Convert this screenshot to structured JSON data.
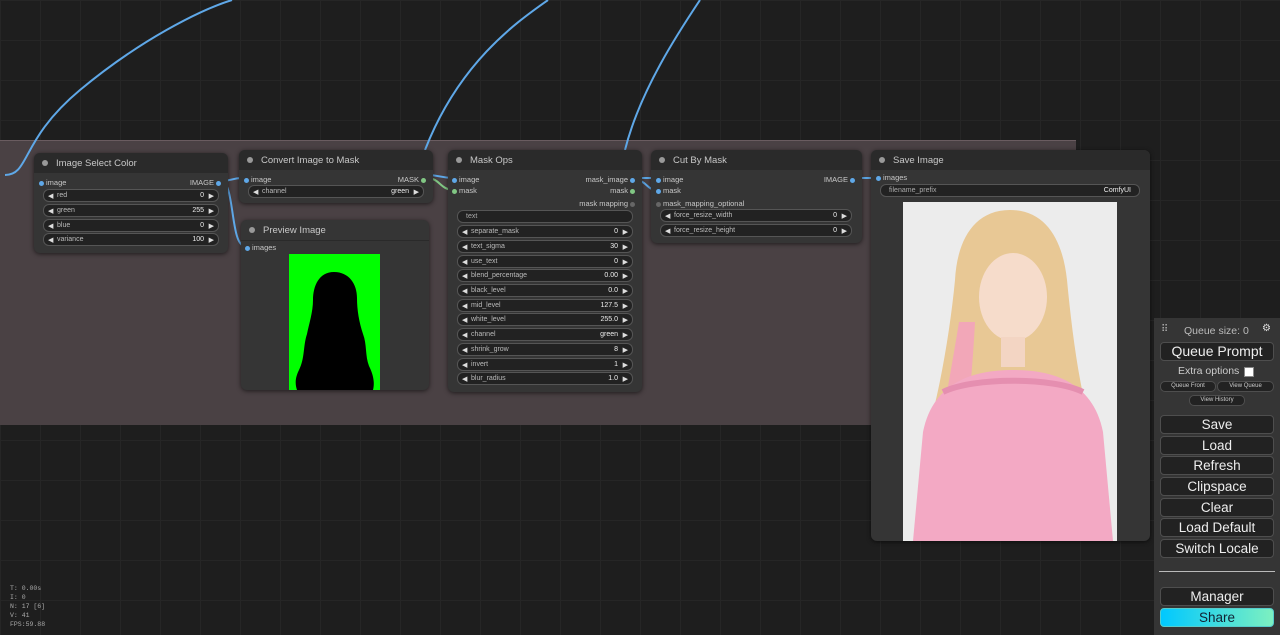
{
  "nodes": {
    "image_select_color": {
      "title": "Image Select Color",
      "input": "image",
      "output": "IMAGE",
      "widgets": [
        {
          "label": "red",
          "value": "0"
        },
        {
          "label": "green",
          "value": "255"
        },
        {
          "label": "blue",
          "value": "0"
        },
        {
          "label": "variance",
          "value": "100"
        }
      ]
    },
    "convert_image_to_mask": {
      "title": "Convert Image to Mask",
      "input": "image",
      "output": "MASK",
      "widgets": [
        {
          "label": "channel",
          "value": "green"
        }
      ]
    },
    "preview_image": {
      "title": "Preview Image",
      "input": "images"
    },
    "mask_ops": {
      "title": "Mask Ops",
      "inputs": [
        "image",
        "mask",
        "mask mapping"
      ],
      "outputs": [
        "mask_image",
        "mask"
      ],
      "text_placeholder": "text",
      "widgets": [
        {
          "label": "separate_mask",
          "value": "0"
        },
        {
          "label": "text_sigma",
          "value": "30"
        },
        {
          "label": "use_text",
          "value": "0"
        },
        {
          "label": "blend_percentage",
          "value": "0.00"
        },
        {
          "label": "black_level",
          "value": "0.0"
        },
        {
          "label": "mid_level",
          "value": "127.5"
        },
        {
          "label": "white_level",
          "value": "255.0"
        },
        {
          "label": "channel",
          "value": "green"
        },
        {
          "label": "shrink_grow",
          "value": "8"
        },
        {
          "label": "invert",
          "value": "1"
        },
        {
          "label": "blur_radius",
          "value": "1.0"
        }
      ]
    },
    "cut_by_mask": {
      "title": "Cut By Mask",
      "inputs": [
        "image",
        "mask",
        "mask_mapping_optional"
      ],
      "output": "IMAGE",
      "widgets": [
        {
          "label": "force_resize_width",
          "value": "0"
        },
        {
          "label": "force_resize_height",
          "value": "0"
        }
      ]
    },
    "save_image": {
      "title": "Save Image",
      "input": "images",
      "widgets": [
        {
          "label": "filename_prefix",
          "value": "ComfyUI"
        }
      ]
    }
  },
  "menu": {
    "queue_size": "Queue size: 0",
    "queue_prompt": "Queue Prompt",
    "extra_options": "Extra options",
    "queue_front": "Queue Front",
    "view_queue": "View Queue",
    "view_history": "View History",
    "save": "Save",
    "load": "Load",
    "refresh": "Refresh",
    "clipspace": "Clipspace",
    "clear": "Clear",
    "load_default": "Load Default",
    "switch_locale": "Switch Locale",
    "manager": "Manager",
    "share": "Share"
  },
  "stats": {
    "t": "T: 0.00s",
    "i": "I: 0",
    "n": "N: 17 [6]",
    "v": "V: 41",
    "fps": "FPS:59.88"
  },
  "colors": {
    "link_image": "#5fa8e8",
    "link_mask": "#81c784",
    "preview_bg": "#00ff00",
    "share_gradient_start": "#00c8ff",
    "share_gradient_end": "#7df0c0"
  }
}
